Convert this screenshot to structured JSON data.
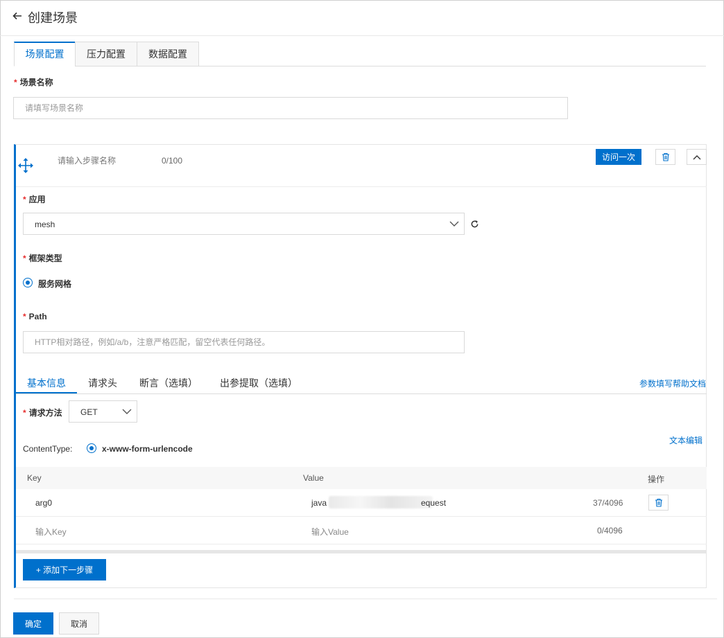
{
  "header": {
    "title": "创建场景",
    "back_icon": "arrow-left-icon"
  },
  "top_tabs": [
    {
      "label": "场景配置",
      "active": true
    },
    {
      "label": "压力配置",
      "active": false
    },
    {
      "label": "数据配置",
      "active": false
    }
  ],
  "scene_name": {
    "required_mark": "*",
    "label": "场景名称",
    "placeholder": "请填写场景名称",
    "value": ""
  },
  "step": {
    "drag_icon": "move-icon",
    "name_placeholder": "请输入步骤名称",
    "name_count": "0/100",
    "visit_once_label": "访问一次",
    "delete_icon": "trash-icon",
    "collapse_icon": "chevron-up-icon",
    "app": {
      "required_mark": "*",
      "label": "应用",
      "value": "mesh",
      "refresh_icon": "refresh-icon"
    },
    "framework": {
      "required_mark": "*",
      "label": "框架类型",
      "option": "服务网格",
      "selected": true
    },
    "path": {
      "required_mark": "*",
      "label": "Path",
      "placeholder": "HTTP相对路径，例如/a/b，注意严格匹配，留空代表任何路径。",
      "value": ""
    },
    "sub_tabs": [
      {
        "label": "基本信息",
        "active": true
      },
      {
        "label": "请求头",
        "active": false
      },
      {
        "label": "断言（选填）",
        "active": false
      },
      {
        "label": "出参提取（选填）",
        "active": false
      }
    ],
    "help_link": "参数填写帮助文档",
    "method": {
      "required_mark": "*",
      "label": "请求方法",
      "value": "GET"
    },
    "content_type": {
      "label": "ContentType:",
      "option": "x-www-form-urlencode",
      "selected": true
    },
    "text_edit_link": "文本编辑",
    "table": {
      "headers": {
        "key": "Key",
        "value": "Value",
        "ops": "操作"
      },
      "rows": [
        {
          "key": "arg0",
          "value_prefix": "java",
          "value_suffix": "equest",
          "count": "37/4096"
        }
      ],
      "new_row": {
        "key_placeholder": "输入Key",
        "value_placeholder": "输入Value",
        "count": "0/4096"
      }
    },
    "add_step_label": "+ 添加下一步骤"
  },
  "footer": {
    "ok_label": "确定",
    "cancel_label": "取消"
  },
  "colors": {
    "accent": "#0070cc",
    "required": "#e62e2e"
  }
}
